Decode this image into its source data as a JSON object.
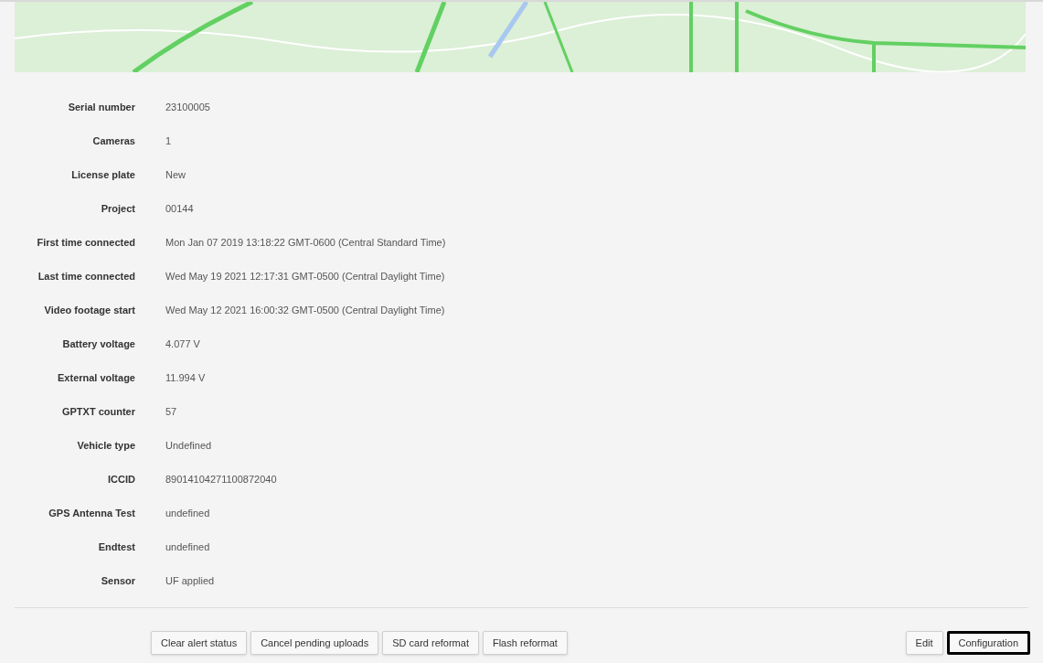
{
  "fields": [
    {
      "label": "Serial number",
      "value": "23100005"
    },
    {
      "label": "Cameras",
      "value": "1"
    },
    {
      "label": "License plate",
      "value": "New"
    },
    {
      "label": "Project",
      "value": "00144"
    },
    {
      "label": "First time connected",
      "value": "Mon Jan 07 2019 13:18:22 GMT-0600 (Central Standard Time)"
    },
    {
      "label": "Last time connected",
      "value": "Wed May 19 2021 12:17:31 GMT-0500 (Central Daylight Time)"
    },
    {
      "label": "Video footage start",
      "value": "Wed May 12 2021 16:00:32 GMT-0500 (Central Daylight Time)"
    },
    {
      "label": "Battery voltage",
      "value": "4.077 V"
    },
    {
      "label": "External voltage",
      "value": "11.994 V"
    },
    {
      "label": "GPTXT counter",
      "value": "57"
    },
    {
      "label": "Vehicle type",
      "value": "Undefined"
    },
    {
      "label": "ICCID",
      "value": "89014104271100872040"
    },
    {
      "label": "GPS Antenna Test",
      "value": "undefined"
    },
    {
      "label": "Endtest",
      "value": "undefined"
    },
    {
      "label": "Sensor",
      "value": "UF applied"
    }
  ],
  "left_buttons": [
    {
      "label": "Clear alert status",
      "focused": false
    },
    {
      "label": "Cancel pending uploads",
      "focused": false
    },
    {
      "label": "SD card reformat",
      "focused": false
    },
    {
      "label": "Flash reformat",
      "focused": false
    }
  ],
  "right_buttons": [
    {
      "label": "Edit",
      "focused": false
    },
    {
      "label": "Configuration",
      "focused": true
    }
  ]
}
